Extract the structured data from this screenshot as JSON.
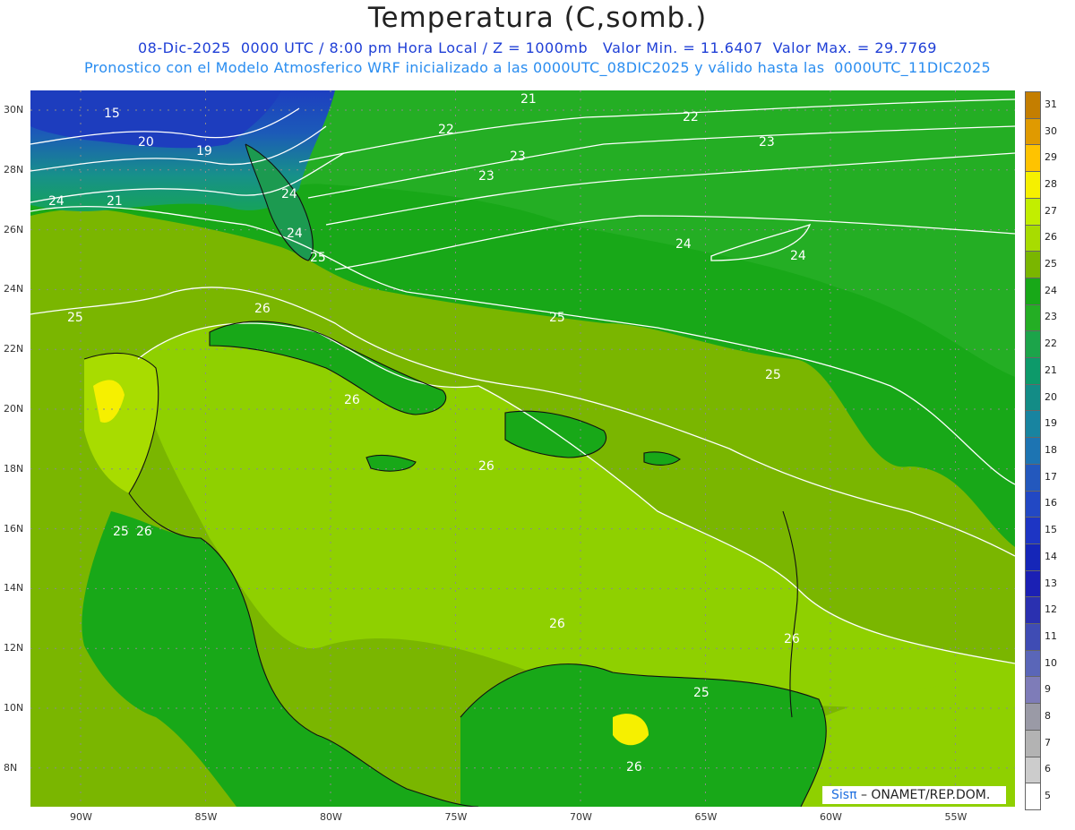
{
  "header": {
    "title": "Temperatura (C,somb.)",
    "line1": "08-Dic-2025  0000 UTC / 8:00 pm Hora Local / Z = 1000mb   Valor Min. = 11.6407  Valor Max. = 29.7769",
    "line2": "Pronostico con el Modelo Atmosferico WRF inicializado a las 0000UTC_08DIC2025 y válido hasta las  0000UTC_11DIC2025"
  },
  "axes": {
    "lon_labels": [
      "90W",
      "85W",
      "80W",
      "75W",
      "70W",
      "65W",
      "60W",
      "55W"
    ],
    "lat_labels": [
      "30N",
      "28N",
      "26N",
      "24N",
      "22N",
      "20N",
      "18N",
      "16N",
      "14N",
      "12N",
      "10N",
      "8N"
    ]
  },
  "colorbar": {
    "levels": [
      "31",
      "30",
      "29",
      "28",
      "27",
      "26",
      "25",
      "24",
      "23",
      "22",
      "21",
      "20",
      "19",
      "18",
      "17",
      "16",
      "15",
      "14",
      "13",
      "12",
      "11",
      "10",
      "9",
      "8",
      "7",
      "6",
      "5"
    ],
    "colors": [
      "#c47e00",
      "#e09a00",
      "#ffc300",
      "#f6f000",
      "#c2ee00",
      "#a8dc00",
      "#7ab600",
      "#18a818",
      "#24ae24",
      "#1ca44a",
      "#0d9a6a",
      "#138c86",
      "#1884a0",
      "#1d74b2",
      "#2358bd",
      "#2248c4",
      "#1d35c4",
      "#1526b8",
      "#1b20b4",
      "#2a30b0",
      "#3f4cb4",
      "#5a66b8",
      "#7e7cb8",
      "#9a9aa6",
      "#b3b3b3",
      "#cccccc",
      "#ffffff"
    ]
  },
  "contour_labels": [
    "15",
    "19",
    "20",
    "21",
    "21",
    "22",
    "22",
    "23",
    "23",
    "23",
    "24",
    "24",
    "24",
    "24",
    "24",
    "25",
    "25",
    "25",
    "25",
    "25",
    "25",
    "26",
    "26",
    "26",
    "26",
    "26",
    "26",
    "26"
  ],
  "credit": {
    "brand": "Sisπ",
    "text": " – ONAMET/REP.DOM."
  }
}
